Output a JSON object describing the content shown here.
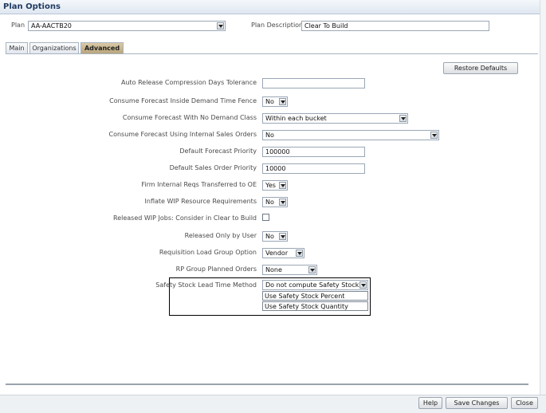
{
  "window": {
    "title": "Plan Options"
  },
  "header": {
    "plan_label": "Plan",
    "plan_value": "AA-AACTB20",
    "plan_description_label": "Plan Description",
    "plan_description_value": "Clear To Build"
  },
  "tabs": [
    {
      "label": "Main",
      "active": false
    },
    {
      "label": "Organizations",
      "active": false
    },
    {
      "label": "Advanced",
      "active": true
    }
  ],
  "restore_defaults_label": "Restore Defaults",
  "form": {
    "auto_release": {
      "label": "Auto Release Compression Days Tolerance",
      "value": ""
    },
    "consume_inside_fence": {
      "label": "Consume Forecast Inside Demand Time Fence",
      "value": "No"
    },
    "consume_no_demand_class": {
      "label": "Consume Forecast With No Demand Class",
      "value": "Within each bucket"
    },
    "consume_internal_orders": {
      "label": "Consume Forecast Using Internal Sales Orders",
      "value": "No"
    },
    "default_forecast_priority": {
      "label": "Default Forecast Priority",
      "value": "100000"
    },
    "default_sales_order_priority": {
      "label": "Default Sales Order Priority",
      "value": "10000"
    },
    "firm_internal_reqs": {
      "label": "Firm Internal Reqs Transferred to OE",
      "value": "Yes"
    },
    "inflate_wip": {
      "label": "Inflate WIP Resource Requirements",
      "value": "No"
    },
    "released_wip_jobs": {
      "label": "Released WIP Jobs: Consider in Clear to Build",
      "checked": false
    },
    "released_only_by_user": {
      "label": "Released Only by User",
      "value": "No"
    },
    "requisition_load_group": {
      "label": "Requisition Load Group Option",
      "value": "Vendor"
    },
    "rp_group_planned_orders": {
      "label": "RP Group Planned Orders",
      "value": "None"
    },
    "safety_stock_method": {
      "label": "Safety Stock Lead Time Method",
      "value": "Do not compute Safety Stock",
      "options": [
        "Use Safety Stock Percent",
        "Use Safety Stock Quantity"
      ]
    }
  },
  "footer": {
    "help": "Help",
    "save": "Save Changes",
    "close": "Close"
  },
  "colors": {
    "accent": "#b9a57c",
    "highlight_border": "#000000"
  }
}
